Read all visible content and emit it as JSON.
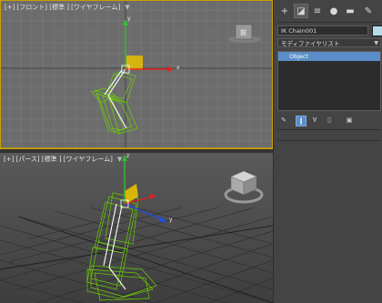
{
  "viewports": {
    "front": {
      "label": "[+] [フロント] [標準 ] [ワイヤフレーム]",
      "menu_glyph": "▼"
    },
    "perspective": {
      "label": "[+] [パース] [標準 ] [ワイヤフレーム]",
      "menu_glyph": "▼"
    },
    "front_viewcube_label": "前"
  },
  "axes": {
    "x": "x",
    "y": "y",
    "z": "z"
  },
  "command_panel": {
    "tabs": [
      {
        "name": "create-tab",
        "glyph": "+"
      },
      {
        "name": "modify-tab",
        "glyph": "◪"
      },
      {
        "name": "hierarchy-tab",
        "glyph": "≡"
      },
      {
        "name": "motion-tab",
        "glyph": "●"
      },
      {
        "name": "display-tab",
        "glyph": "▬"
      },
      {
        "name": "utilities-tab",
        "glyph": "✎"
      }
    ],
    "object_name": "IK Chain001",
    "modifier_list": "モディファイヤリスト",
    "modifier_stack": [
      "Object"
    ]
  },
  "colors": {
    "active_border": "#c8a000",
    "wire_green": "#6bd000",
    "selection_blue": "#5b8ec8",
    "object_color": "#b6dce6"
  }
}
